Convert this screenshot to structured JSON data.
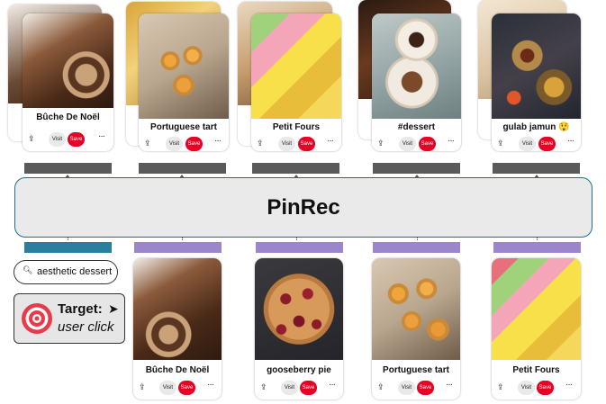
{
  "model": {
    "label": "PinRec"
  },
  "query": {
    "text": "aesthetic dessert"
  },
  "target": {
    "title": "Target:",
    "subtitle": "user click"
  },
  "pin_actions": {
    "visit": "Visit",
    "save": "Save",
    "more": "···"
  },
  "output_pins": [
    {
      "title": "Bûche De Noël"
    },
    {
      "title": "Portuguese tart"
    },
    {
      "title": "Petit Fours"
    },
    {
      "title": "#dessert"
    },
    {
      "title": "gulab jamun 😲"
    }
  ],
  "input_pins": [
    {
      "title": "Bûche De Noël"
    },
    {
      "title": "gooseberry pie"
    },
    {
      "title": "Portuguese tart"
    },
    {
      "title": "Petit Fours"
    }
  ],
  "colors": {
    "model_box": "#eaeaea",
    "model_border": "#1f6f8b",
    "output_token": "#5a5a5a",
    "query_token": "#2a7f9e",
    "pin_token": "#9b86cc",
    "save_button": "#e60023"
  }
}
